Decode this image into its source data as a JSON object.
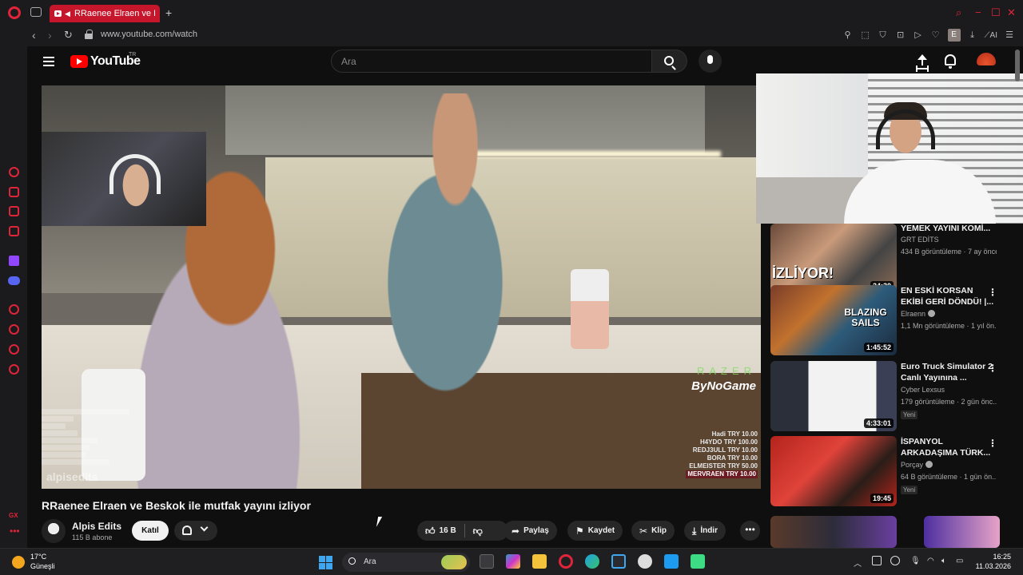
{
  "browser": {
    "tab_title": "RRaenee Elraen ve Be",
    "new_tab": "+",
    "url": "www.youtube.com/watch",
    "profile_initial": "E",
    "ai_label": "AI"
  },
  "youtube": {
    "logo_text": "YouTube",
    "country_code": "TR",
    "search_placeholder": "Ara"
  },
  "video": {
    "title": "RRaenee Elraen ve Beskok ile mutfak yayını izliyor",
    "watermark": "alpisedits",
    "brand_top": "RAZER",
    "brand": "ByNoGame",
    "donations": [
      {
        "text": "Hadi   TRY 10.00",
        "hl": false
      },
      {
        "text": "H4YDO  TRY 100.00",
        "hl": false
      },
      {
        "text": "REDJ3ULL  TRY 10.00",
        "hl": false
      },
      {
        "text": "BORA  TRY 10.00",
        "hl": false
      },
      {
        "text": "ELMEISTER  TRY 50.00",
        "hl": false
      },
      {
        "text": "MERVRAEN  TRY 10.00",
        "hl": true
      }
    ]
  },
  "channel": {
    "name": "Alpis Edits",
    "subs": "115 B abone",
    "join": "Katıl"
  },
  "actions": {
    "likes": "16 B",
    "share": "Paylaş",
    "save": "Kaydet",
    "clip": "Klip",
    "download": "İndir",
    "more": "•••"
  },
  "recommendations": [
    {
      "title": "YEMEK YAYINI KOMİ...",
      "channel": "GRT EDİTS",
      "meta": "434 B görüntüleme · 7 ay önce",
      "duration": "24:30",
      "thumb_text": "İZLİYOR!",
      "verified": false,
      "new": ""
    },
    {
      "title": "EN ESKİ KORSAN EKİBİ GERİ DÖNDÜ! |...",
      "channel": "Elraenn",
      "meta": "1,1 Mn görüntüleme · 1 yıl ön...",
      "duration": "1:45:52",
      "thumb_text": "BLAZING SAILS",
      "verified": true,
      "new": ""
    },
    {
      "title": "Euro Truck Simulator 2 Canlı Yayınına ...",
      "channel": "Cyber Lexsus",
      "meta": "179 görüntüleme · 2 gün önc...",
      "duration": "4:33:01",
      "thumb_text": "",
      "verified": false,
      "new": "Yeni"
    },
    {
      "title": "İSPANYOL ARKADAŞIMA TÜRK...",
      "channel": "Porçay",
      "meta": "64 B görüntüleme · 1 gün ön...",
      "duration": "19:45",
      "thumb_text": "",
      "verified": true,
      "new": "Yeni"
    }
  ],
  "taskbar": {
    "temp": "17°C",
    "weather": "Güneşli",
    "search": "Ara",
    "time": "16:25",
    "date": "11.03.2026"
  },
  "sidebar": {
    "gx": "GX",
    "more": "•••"
  },
  "colors": {
    "opera_red": "#e0243a",
    "yt_red": "#ff0000",
    "background": "#0f0f0f"
  }
}
